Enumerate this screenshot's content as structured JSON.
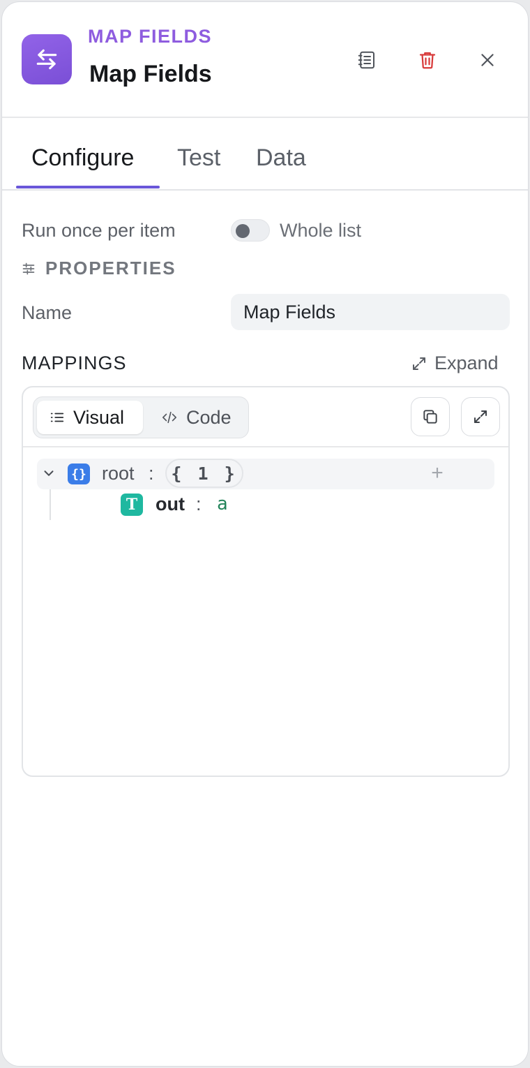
{
  "header": {
    "kind_label": "MAP FIELDS",
    "title": "Map Fields",
    "accent_color": "#8e5cdf",
    "actions": [
      {
        "icon": "notebook-icon",
        "label": "Notes"
      },
      {
        "icon": "trash-icon",
        "label": "Delete",
        "color": "#d83a3a"
      },
      {
        "icon": "close-icon",
        "label": "Close"
      }
    ]
  },
  "tabs": [
    {
      "label": "Configure",
      "active": true
    },
    {
      "label": "Test",
      "active": false
    },
    {
      "label": "Data",
      "active": false
    }
  ],
  "run_mode": {
    "left_label": "Run once per item",
    "right_label": "Whole list",
    "whole_list_enabled": false
  },
  "properties": {
    "section_title": "PROPERTIES",
    "name_label": "Name",
    "name_value": "Map Fields"
  },
  "mappings": {
    "section_title": "MAPPINGS",
    "expand_label": "Expand",
    "view_modes": [
      {
        "label": "Visual",
        "active": true
      },
      {
        "label": "Code",
        "active": false
      }
    ],
    "tree": {
      "root": {
        "key": "root",
        "type": "object",
        "count_label": "{ 1 }",
        "badge": "{}"
      },
      "children": [
        {
          "key": "out",
          "type": "text",
          "badge": "T",
          "value": "a"
        }
      ]
    },
    "colon": ":",
    "add_symbol": "+"
  }
}
